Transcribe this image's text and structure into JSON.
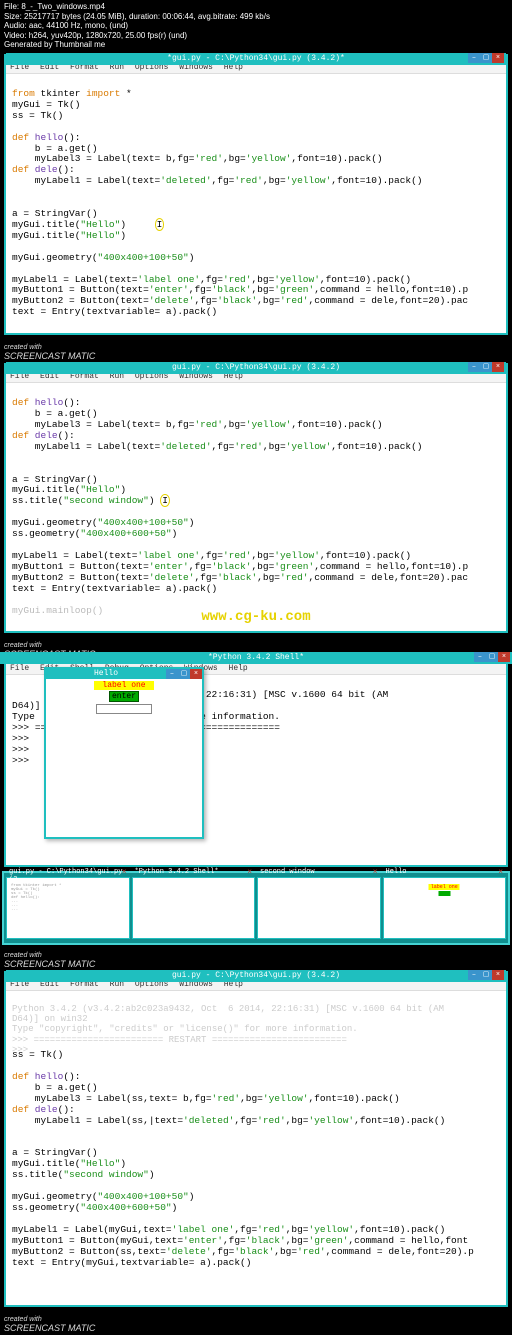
{
  "ffprobe": {
    "l1": "File: 8_-_Two_windows.mp4",
    "l2": "Size: 25217717 bytes (24.05 MiB), duration: 00:06:44, avg.bitrate: 499 kb/s",
    "l3": "Audio: aac, 44100 Hz, mono, (und)",
    "l4": "Video: h264, yuv420p, 1280x720, 25.00 fps(r) (und)",
    "l5": "Generated by Thumbnail me"
  },
  "watermark": "www.cg-ku.com",
  "screencast": "SCREENCAST MATIC",
  "screencast_pre": "created with",
  "editor1": {
    "title": "*gui.py - C:\\Python34\\gui.py (3.4.2)*",
    "menu": [
      "File",
      "Edit",
      "Format",
      "Run",
      "Options",
      "Windows",
      "Help"
    ],
    "code": {
      "l1a": "from",
      "l1b": " tkinter ",
      "l1c": "import",
      "l1d": " *",
      "l2": "myGui = Tk()",
      "l3": "ss = Tk()",
      "l4": "",
      "l5a": "def",
      "l5b": " hello",
      "l5c": "():",
      "l6": "    b = a.get()",
      "l7a": "    myLabel3 = Label(text= b,fg=",
      "l7b": "'red'",
      "l7c": ",bg=",
      "l7d": "'yellow'",
      "l7e": ",font=10).pack()",
      "l8a": "def",
      "l8b": " dele",
      "l8c": "():",
      "l9a": "    myLabel1 = Label(text=",
      "l9b": "'deleted'",
      "l9c": ",fg=",
      "l9d": "'red'",
      "l9e": ",bg=",
      "l9f": "'yellow'",
      "l9g": ",font=10).pack()",
      "l10": "",
      "l11": "",
      "l12": "a = StringVar()",
      "l13a": "myGui.title(",
      "l13b": "\"Hello\"",
      "l13c": ")",
      "l14a": "myGui.title(",
      "l14b": "\"Hello\"",
      "l14c": ")",
      "l15": "",
      "l16a": "myGui.geometry(",
      "l16b": "\"400x400+100+50\"",
      "l16c": ")",
      "l17": "",
      "l18a": "myLabel1 = Label(text=",
      "l18b": "'label one'",
      "l18c": ",fg=",
      "l18d": "'red'",
      "l18e": ",bg=",
      "l18f": "'yellow'",
      "l18g": ",font=10).pack()",
      "l19a": "myButton1 = Button(text=",
      "l19b": "'enter'",
      "l19c": ",fg=",
      "l19d": "'black'",
      "l19e": ",bg=",
      "l19f": "'green'",
      "l19g": ",command = hello,font=10).p",
      "l20a": "myButton2 = Button(text=",
      "l20b": "'delete'",
      "l20c": ",fg=",
      "l20d": "'black'",
      "l20e": ",bg=",
      "l20f": "'red'",
      "l20g": ",command = dele,font=20).pac",
      "l21": "text = Entry(textvariable= a).pack()"
    }
  },
  "editor2": {
    "title": "gui.py - C:\\Python34\\gui.py (3.4.2)",
    "menu": [
      "File",
      "Edit",
      "Format",
      "Run",
      "Options",
      "Windows",
      "Help"
    ],
    "code": {
      "l5a": "def",
      "l5b": " hello",
      "l5c": "():",
      "l6": "    b = a.get()",
      "l7a": "    myLabel3 = Label(text= b,fg=",
      "l7b": "'red'",
      "l7c": ",bg=",
      "l7d": "'yellow'",
      "l7e": ",font=10).pack()",
      "l8a": "def",
      "l8b": " dele",
      "l8c": "():",
      "l9a": "    myLabel1 = Label(text=",
      "l9b": "'deleted'",
      "l9c": ",fg=",
      "l9d": "'red'",
      "l9e": ",bg=",
      "l9f": "'yellow'",
      "l9g": ",font=10).pack()",
      "l10": "",
      "l11": "",
      "l12": "a = StringVar()",
      "l13a": "myGui.title(",
      "l13b": "\"Hello\"",
      "l13c": ")",
      "l14a": "ss.title(",
      "l14b": "\"second window\"",
      "l14c": ")",
      "l15": "",
      "l16a": "myGui.geometry(",
      "l16b": "\"400x400+100+50\"",
      "l16c": ")",
      "l17a": "ss.geometry(",
      "l17b": "\"400x400+600+50\"",
      "l17c": ")",
      "l18": "",
      "l19a": "myLabel1 = Label(text=",
      "l19b": "'label one'",
      "l19c": ",fg=",
      "l19d": "'red'",
      "l19e": ",bg=",
      "l19f": "'yellow'",
      "l19g": ",font=10).pack()",
      "l20a": "myButton1 = Button(text=",
      "l20b": "'enter'",
      "l20c": ",fg=",
      "l20d": "'black'",
      "l20e": ",bg=",
      "l20f": "'green'",
      "l20g": ",command = hello,font=10).p",
      "l21a": "myButton2 = Button(text=",
      "l21b": "'delete'",
      "l21c": ",fg=",
      "l21d": "'black'",
      "l21e": ",bg=",
      "l21f": "'red'",
      "l21g": ",command = dele,font=20).pac",
      "l22": "text = Entry(textvariable= a).pack()",
      "l23": "",
      "l24": "myGui.mainloop()"
    }
  },
  "shell": {
    "title": "*Python 3.4.2 Shell*",
    "menu": [
      "File",
      "Edit",
      "Shell",
      "Debug",
      "Options",
      "Windows",
      "Help"
    ],
    "l0": "       3.4.2         Oct  6 2014, 22:16:31) [MSC v.1600 64 bit (AM",
    "l1": "D64)]",
    "l2a": "Type             ",
    "l2b": "cense()\" for more information.",
    "l3a": ">>> ",
    "l3b": "=== RESTART ===============================",
    "l4": ">>> ",
    "l5": ">>> ",
    "l6": ">>> "
  },
  "tk": {
    "title": "Hello",
    "label": "label one",
    "enter": "enter"
  },
  "taskbar": {
    "t1": "gui.py - C:\\Python34\\gui.py (3....",
    "t2": "*Python 3.4.2 Shell*",
    "t3": "second window",
    "t4": "Hello"
  },
  "editor3": {
    "title": "gui.py - C:\\Python34\\gui.py (3.4.2)",
    "menu": [
      "File",
      "Edit",
      "Format",
      "Run",
      "Options",
      "Windows",
      "Help"
    ],
    "ghost": {
      "g1": "Python 3.4.2 (v3.4.2:ab2c023a9432, Oct  6 2014, 22:16:31) [MSC v.1600 64 bit (AM",
      "g2": "D64)] on win32",
      "g3": "Type \"copyright\", \"credits\" or \"license()\" for more information.",
      "g4": ">>> ======================== RESTART =========================",
      "g5": ">>> "
    },
    "code": {
      "l0": "ss = Tk()",
      "l1": "",
      "l2a": "def",
      "l2b": " hello",
      "l2c": "():",
      "l3": "    b = a.get()",
      "l4a": "    myLabel3 = Label(ss,text= b,fg=",
      "l4b": "'red'",
      "l4c": ",bg=",
      "l4d": "'yellow'",
      "l4e": ",font=10).pack()",
      "l5a": "def",
      "l5b": " dele",
      "l5c": "():",
      "l6a": "    myLabel1 = Label(ss,|text=",
      "l6b": "'deleted'",
      "l6c": ",fg=",
      "l6d": "'red'",
      "l6e": ",bg=",
      "l6f": "'yellow'",
      "l6g": ",font=10).pack()",
      "l7": "",
      "l8": "",
      "l9": "a = StringVar()",
      "l10a": "myGui.title(",
      "l10b": "\"Hello\"",
      "l10c": ")",
      "l11a": "ss.title(",
      "l11b": "\"second window\"",
      "l11c": ")",
      "l12": "",
      "l13a": "myGui.geometry(",
      "l13b": "\"400x400+100+50\"",
      "l13c": ")",
      "l14a": "ss.geometry(",
      "l14b": "\"400x400+600+50\"",
      "l14c": ")",
      "l15": "",
      "l16a": "myLabel1 = Label(myGui,text=",
      "l16b": "'label one'",
      "l16c": ",fg=",
      "l16d": "'red'",
      "l16e": ",bg=",
      "l16f": "'yellow'",
      "l16g": ",font=10).pack()",
      "l17a": "myButton1 = Button(myGui,text=",
      "l17b": "'enter'",
      "l17c": ",fg=",
      "l17d": "'black'",
      "l17e": ",bg=",
      "l17f": "'green'",
      "l17g": ",command = hello,font",
      "l18a": "myButton2 = Button(ss,text=",
      "l18b": "'delete'",
      "l18c": ",fg=",
      "l18d": "'black'",
      "l18e": ",bg=",
      "l18f": "'red'",
      "l18g": ",command = dele,font=20).p",
      "l19": "text = Entry(myGui,textvariable= a).pack()"
    }
  }
}
